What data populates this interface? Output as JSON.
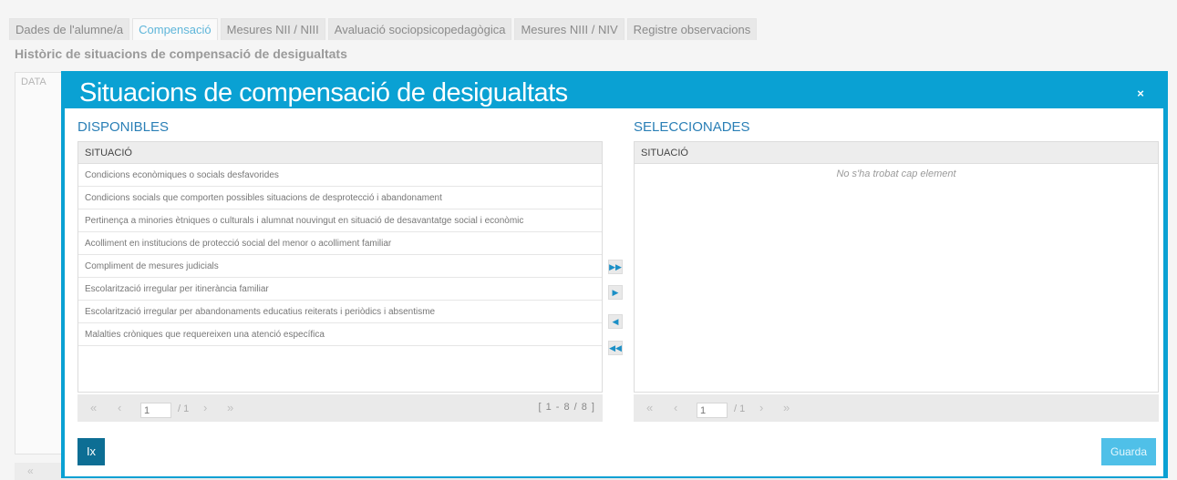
{
  "tabs": [
    {
      "label": "Dades de l'alumne/a",
      "active": false
    },
    {
      "label": "Compensació",
      "active": true
    },
    {
      "label": "Mesures NII / NIII",
      "active": false
    },
    {
      "label": "Avaluació sociopsicopedagògica",
      "active": false
    },
    {
      "label": "Mesures NIII / NIV",
      "active": false
    },
    {
      "label": "Registre observacions",
      "active": false
    }
  ],
  "page": {
    "title": "Històric de situacions de compensació de desigualtats",
    "table_header": "DATA",
    "pager_first": "«"
  },
  "modal": {
    "title": "Situacions de compensació de desigualtats",
    "close_icon": "×",
    "available": {
      "title": "DISPONIBLES",
      "column_header": "SITUACIÓ",
      "items": [
        "Condicions econòmiques o socials desfavorides",
        "Condicions socials que comporten possibles situacions de desprotecció i abandonament",
        "Pertinença a minories ètniques o culturals i alumnat nouvingut en situació de desavantatge social i econòmic",
        "Acolliment en institucions de protecció social del menor o acolliment familiar",
        "Compliment de mesures judicials",
        "Escolarització irregular per itinerància familiar",
        "Escolarització irregular per abandonaments educatius reiterats i periòdics i absentisme",
        "Malalties cròniques que requereixen una atenció específica"
      ],
      "pager": {
        "first": "«",
        "prev": "‹",
        "page": "1",
        "total": "/ 1",
        "next": "›",
        "last": "»",
        "count": "[ 1 - 8 / 8 ]"
      }
    },
    "selected": {
      "title": "SELECCIONADES",
      "column_header": "SITUACIÓ",
      "empty_message": "No s'ha trobat cap element",
      "pager": {
        "first": "«",
        "prev": "‹",
        "page": "1",
        "total": "/ 1",
        "next": "›",
        "last": "»"
      }
    },
    "move_buttons": {
      "move_all_right": "▶▶",
      "move_right": "▶",
      "move_left": "◀",
      "move_all_left": "◀◀"
    },
    "close_button": "Ix",
    "save_button": "Guarda"
  },
  "colors": {
    "modal_accent": "#0aa1d3",
    "section_title": "#2a7fb6",
    "close_button": "#0d6e94",
    "save_button": "#4fc0e8",
    "active_tab": "#5fb6da"
  }
}
